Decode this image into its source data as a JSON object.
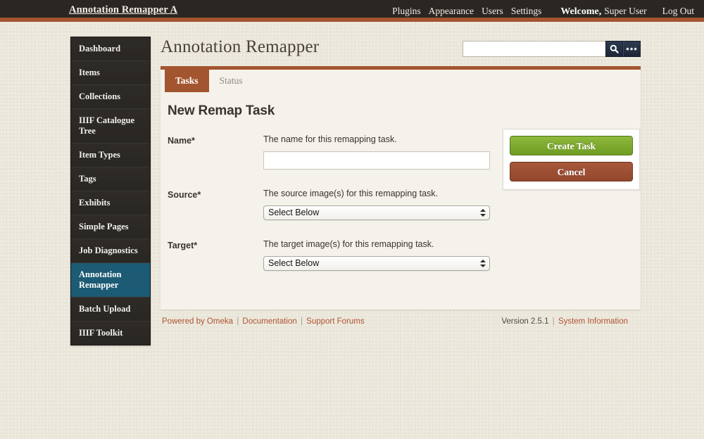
{
  "header": {
    "site_title": "Annotation Remapper A",
    "nav": [
      {
        "label": "Plugins"
      },
      {
        "label": "Appearance"
      },
      {
        "label": "Users"
      },
      {
        "label": "Settings"
      }
    ],
    "welcome_label": "Welcome,",
    "user_name": "Super User",
    "logout_label": "Log Out"
  },
  "sidebar": {
    "items": [
      {
        "label": "Dashboard",
        "active": false
      },
      {
        "label": "Items",
        "active": false
      },
      {
        "label": "Collections",
        "active": false
      },
      {
        "label": "IIIF Catalogue Tree",
        "active": false
      },
      {
        "label": "Item Types",
        "active": false
      },
      {
        "label": "Tags",
        "active": false
      },
      {
        "label": "Exhibits",
        "active": false
      },
      {
        "label": "Simple Pages",
        "active": false
      },
      {
        "label": "Job Diagnostics",
        "active": false
      },
      {
        "label": "Annotation Remapper",
        "active": true
      },
      {
        "label": "Batch Upload",
        "active": false
      },
      {
        "label": "IIIF Toolkit",
        "active": false
      }
    ]
  },
  "main": {
    "page_title": "Annotation Remapper",
    "search": {
      "value": "",
      "placeholder": "",
      "search_icon": "search-icon",
      "advanced_icon": "ellipsis-icon"
    },
    "tabs": [
      {
        "label": "Tasks",
        "active": true
      },
      {
        "label": "Status",
        "active": false
      }
    ],
    "form": {
      "heading": "New Remap Task",
      "fields": [
        {
          "label": "Name*",
          "description": "The name for this remapping task.",
          "type": "text",
          "value": "",
          "placeholder": ""
        },
        {
          "label": "Source*",
          "description": "The source image(s) for this remapping task.",
          "type": "select",
          "value": "Select Below"
        },
        {
          "label": "Target*",
          "description": "The target image(s) for this remapping task.",
          "type": "select",
          "value": "Select Below"
        }
      ]
    },
    "actions": {
      "create_label": "Create Task",
      "cancel_label": "Cancel"
    }
  },
  "footer": {
    "powered_by": "Powered by Omeka",
    "documentation": "Documentation",
    "support_forums": "Support Forums",
    "version": "Version 2.5.1",
    "system_information": "System Information",
    "separator": "|"
  },
  "colors": {
    "header_bg": "#2a2622",
    "accent_rust": "#a3552f",
    "active_nav": "#1d5a74",
    "page_bg": "#eae7da",
    "panel_bg": "#f4f2ea",
    "create_green": "#7da92e",
    "cancel_brown": "#9d4f30",
    "link_rust": "#b05232",
    "search_btn_navy": "#223049"
  }
}
